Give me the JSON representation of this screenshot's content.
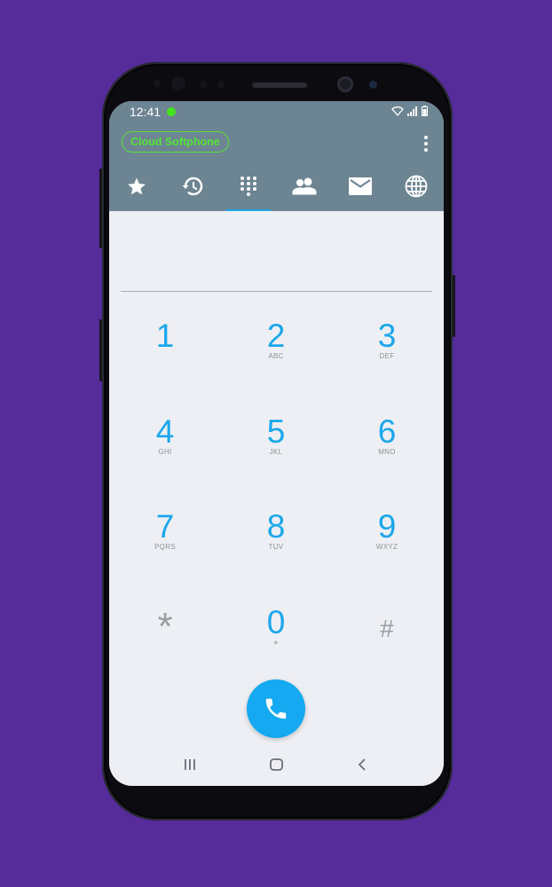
{
  "status_bar": {
    "time": "12:41"
  },
  "app": {
    "name": "Cloud Softphone"
  },
  "tabs": [
    {
      "id": "favorites",
      "icon": "star-icon"
    },
    {
      "id": "history",
      "icon": "history-icon"
    },
    {
      "id": "dialpad",
      "icon": "dialpad-icon",
      "active": true
    },
    {
      "id": "contacts",
      "icon": "contacts-icon"
    },
    {
      "id": "messages",
      "icon": "mail-icon"
    },
    {
      "id": "web",
      "icon": "globe-icon"
    }
  ],
  "dialer": {
    "number": "",
    "keys": [
      {
        "digit": "1",
        "letters": ""
      },
      {
        "digit": "2",
        "letters": "ABC"
      },
      {
        "digit": "3",
        "letters": "DEF"
      },
      {
        "digit": "4",
        "letters": "GHI"
      },
      {
        "digit": "5",
        "letters": "JKL"
      },
      {
        "digit": "6",
        "letters": "MNO"
      },
      {
        "digit": "7",
        "letters": "PQRS"
      },
      {
        "digit": "8",
        "letters": "TUV"
      },
      {
        "digit": "9",
        "letters": "WXYZ"
      },
      {
        "digit": "*",
        "letters": ""
      },
      {
        "digit": "0",
        "letters": "+"
      },
      {
        "digit": "#",
        "letters": ""
      }
    ]
  },
  "colors": {
    "background": "#552c9a",
    "header": "#6d8492",
    "accent": "#1aa7ec",
    "app_pill": "#54e23a",
    "screen": "#eeeff4"
  }
}
